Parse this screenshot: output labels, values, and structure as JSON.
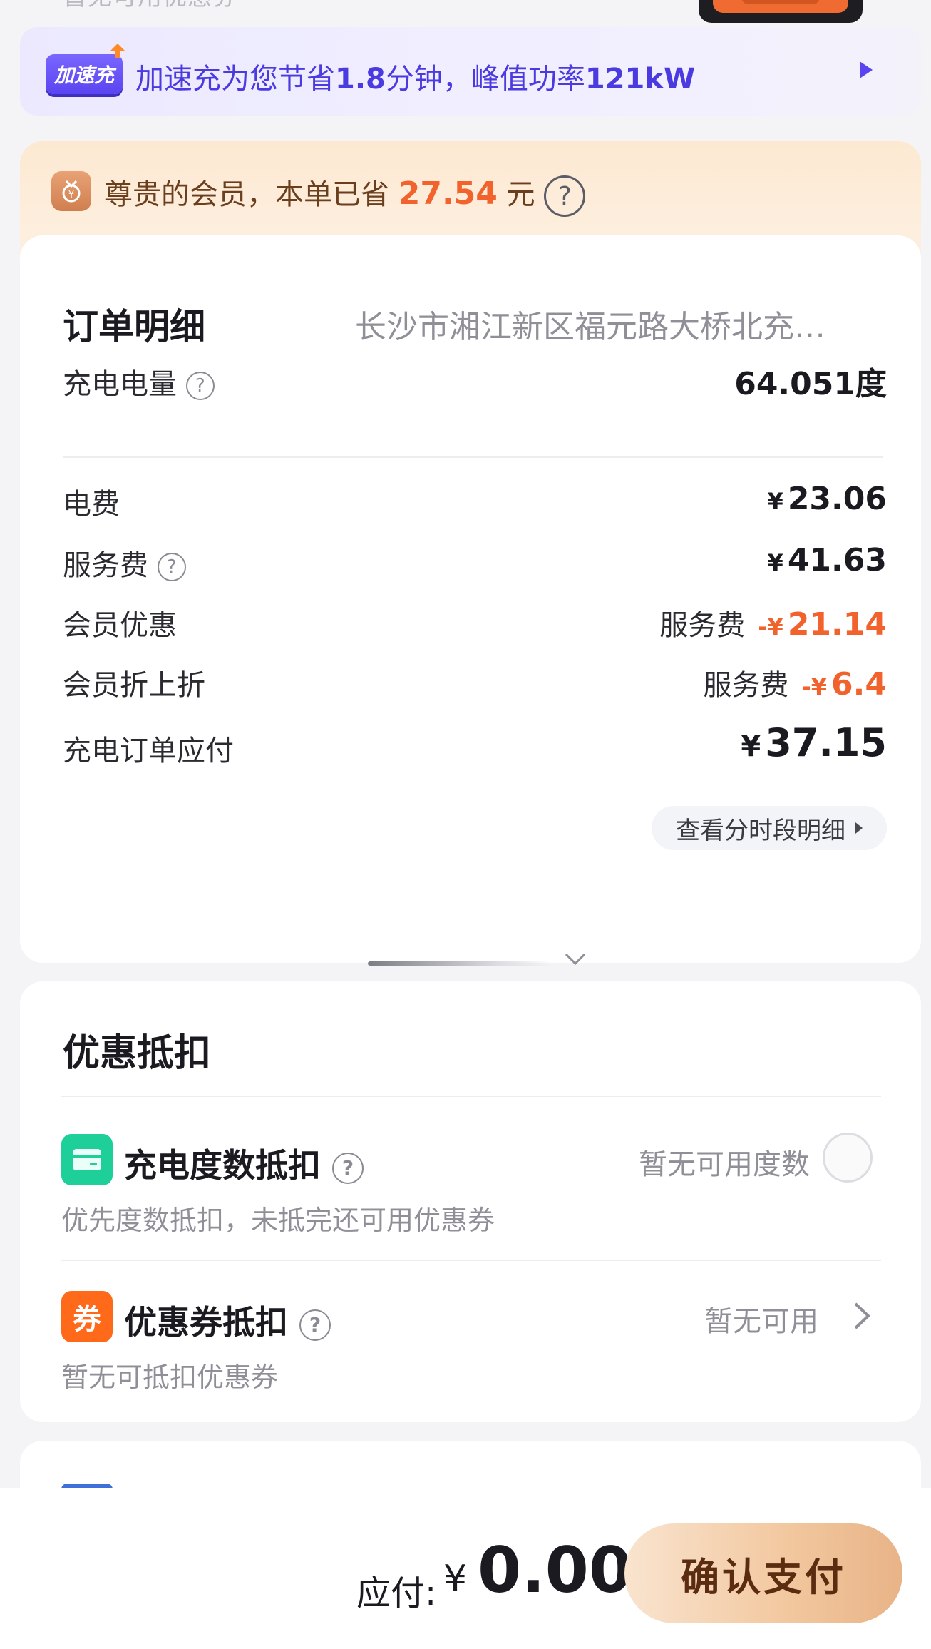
{
  "top": {
    "cropped_text": "暂无可用优惠券"
  },
  "speed_banner": {
    "badge": "加速充",
    "text_prefix": "加速充为您节省",
    "minutes": "1.8",
    "text_mid": "分钟，峰值功率",
    "power": "121kW"
  },
  "member": {
    "icon": "medal-icon",
    "text_prefix": "尊贵的会员，本单已省",
    "amount": "27.54",
    "unit": "元",
    "help": "?"
  },
  "order": {
    "title": "订单明细",
    "station": "长沙市湘江新区福元路大桥北充…",
    "rows": [
      {
        "label": "充电电量",
        "has_help": true,
        "value": "64.051度"
      },
      {
        "label": "电费",
        "yen": "¥",
        "value": "23.06"
      },
      {
        "label": "服务费",
        "has_help": true,
        "yen": "¥",
        "value": "41.63"
      },
      {
        "label": "会员优惠",
        "note": "服务费",
        "yen": "-¥",
        "value": "21.14"
      },
      {
        "label": "会员折上折",
        "note": "服务费",
        "yen": "-¥",
        "value": "6.4"
      },
      {
        "label": "充电订单应付",
        "yen": "¥",
        "value": "37.15"
      }
    ],
    "detail_button": "查看分时段明细",
    "help": "?"
  },
  "discount": {
    "title": "优惠抵扣",
    "items": [
      {
        "icon": "card-icon",
        "title": "充电度数抵扣",
        "sub": "优先度数抵扣，未抵完还可用优惠券",
        "right": "暂无可用度数"
      },
      {
        "icon": "coupon-icon",
        "icon_char": "券",
        "title": "优惠券抵扣",
        "sub": "暂无可抵扣优惠券",
        "right": "暂无可用"
      }
    ]
  },
  "bottom": {
    "label": "应付:",
    "yen": "¥",
    "amount": "0.00",
    "pay_button": "确认支付"
  },
  "colors": {
    "accent_orange": "#f2622d",
    "speed_purple": "#5a44f0",
    "card_green": "#1fcf9a",
    "coupon_orange": "#ff6a1a"
  }
}
